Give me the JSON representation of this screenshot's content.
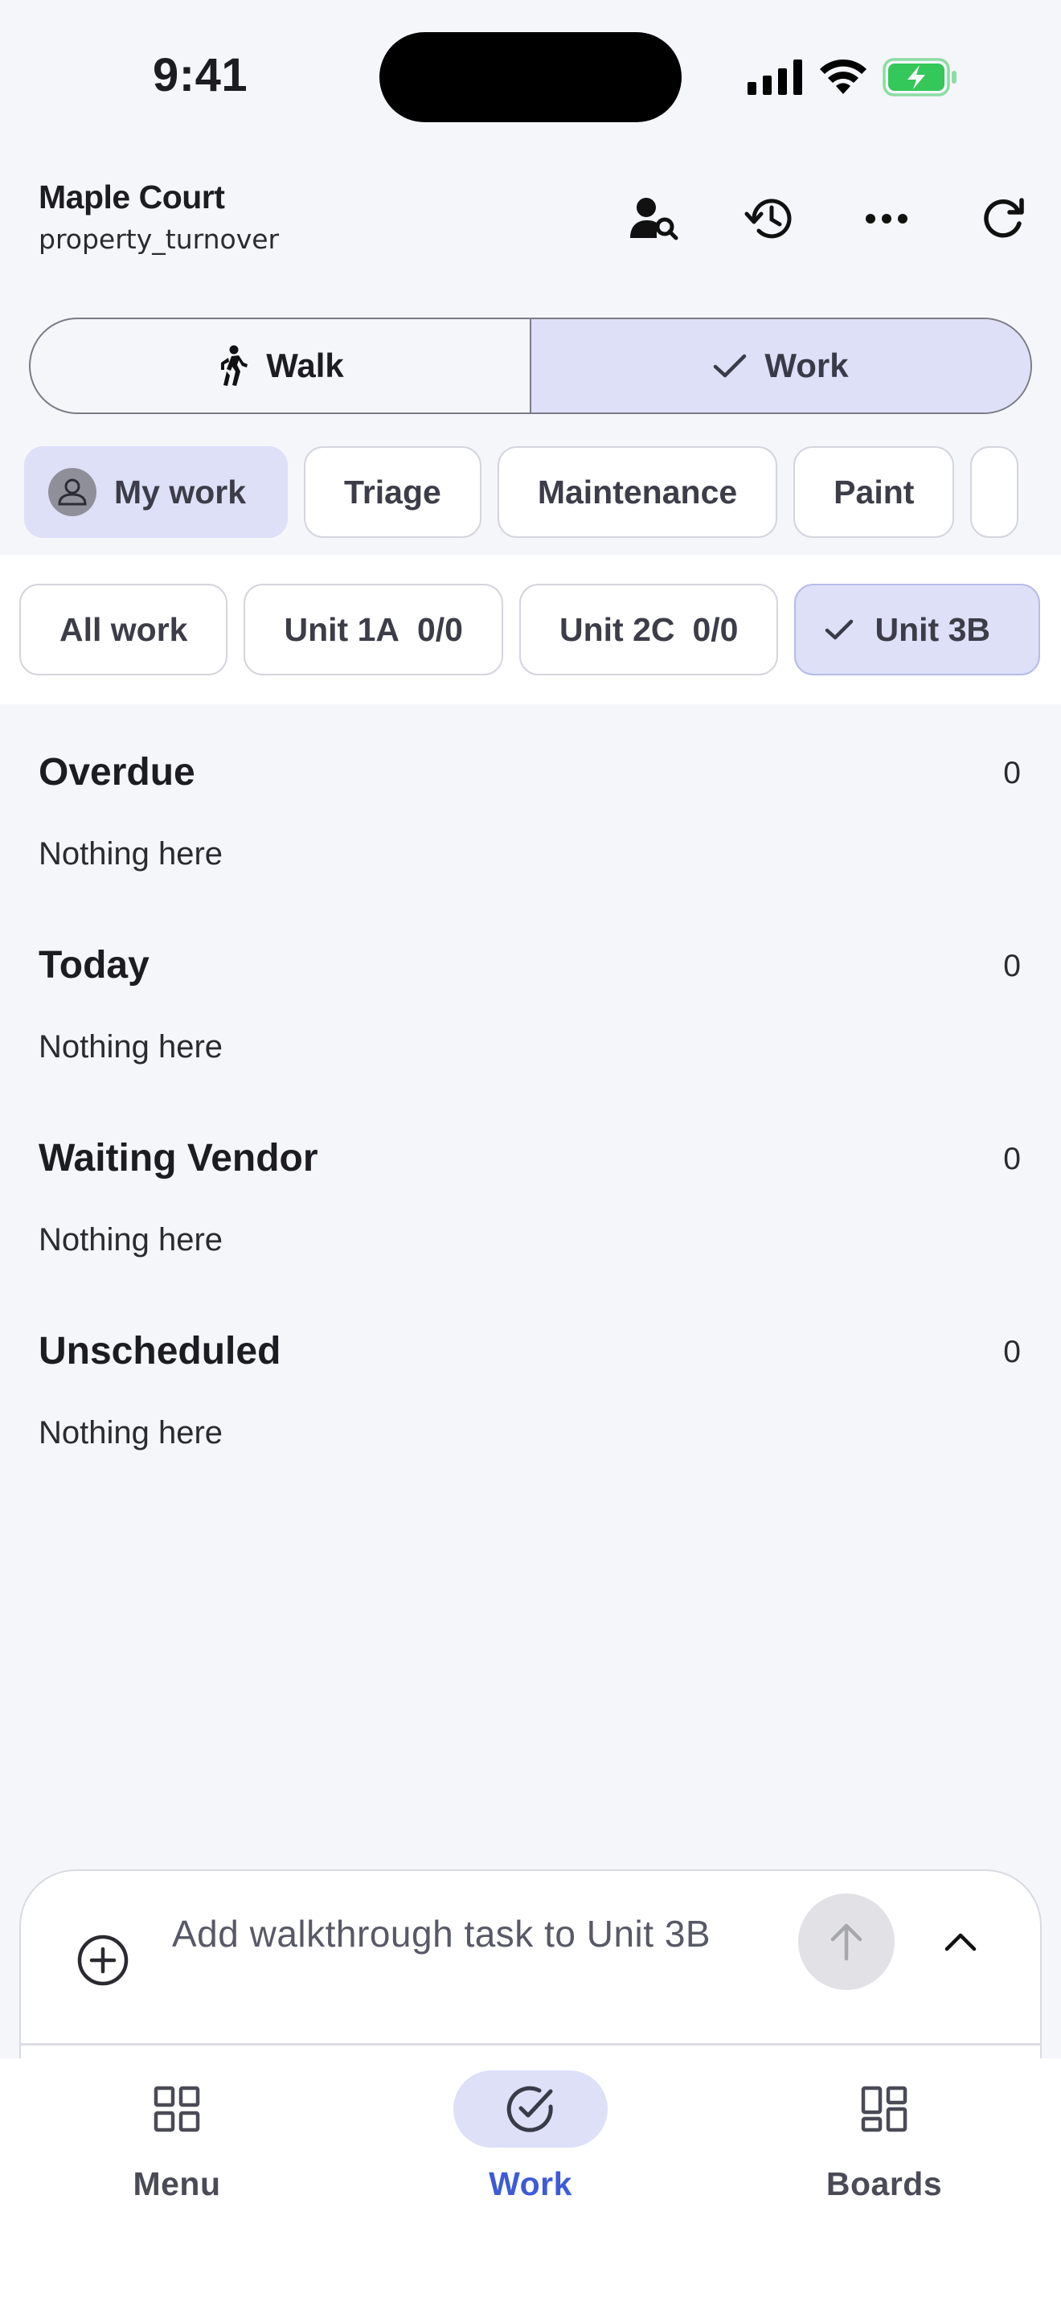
{
  "status_bar": {
    "time": "9:41"
  },
  "header": {
    "title": "Maple Court",
    "subtitle": "property_turnover",
    "actions": [
      "person-search-icon",
      "history-icon",
      "more-icon",
      "refresh-icon"
    ]
  },
  "mode_toggle": {
    "walk_label": "Walk",
    "work_label": "Work",
    "selected": "Work"
  },
  "filters": {
    "my_work": "My work",
    "triage": "Triage",
    "maintenance": "Maintenance",
    "paint": "Paint"
  },
  "units": {
    "all_work": "All work",
    "unit_1a": {
      "name": "Unit 1A",
      "count": "0/0"
    },
    "unit_2c": {
      "name": "Unit 2C",
      "count": "0/0"
    },
    "unit_3b": {
      "name": "Unit 3B",
      "selected": true
    }
  },
  "sections": [
    {
      "title": "Overdue",
      "count": "0",
      "empty": "Nothing here"
    },
    {
      "title": "Today",
      "count": "0",
      "empty": "Nothing here"
    },
    {
      "title": "Waiting Vendor",
      "count": "0",
      "empty": "Nothing here"
    },
    {
      "title": "Unscheduled",
      "count": "0",
      "empty": "Nothing here"
    }
  ],
  "composer": {
    "placeholder": "Add walkthrough task to Unit 3B"
  },
  "bottom_nav": {
    "menu": "Menu",
    "work": "Work",
    "boards": "Boards",
    "active": "Work"
  },
  "colors": {
    "background": "#f5f6fa",
    "selected_fill": "#dde0f7",
    "accent": "#3d5bd6",
    "battery": "#34c759"
  }
}
